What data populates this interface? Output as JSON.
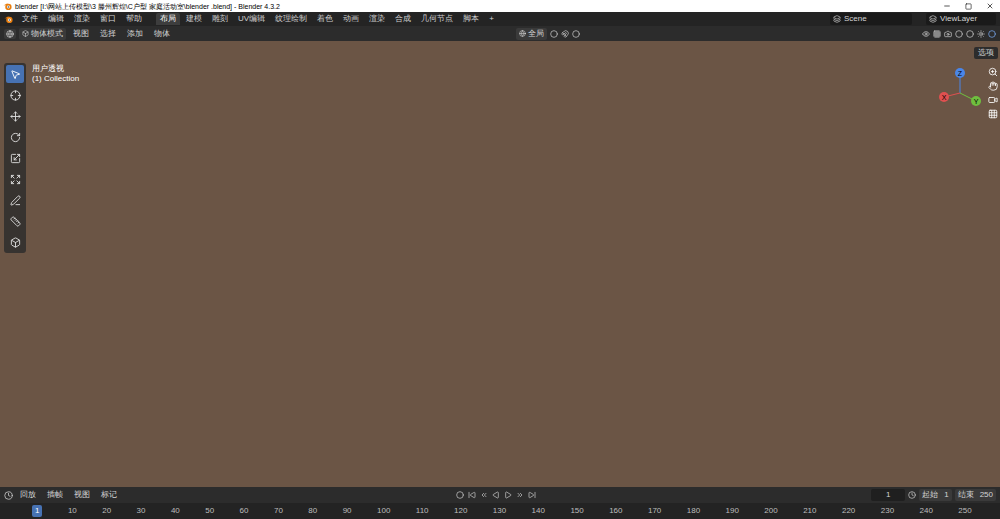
{
  "window": {
    "title": "blender [I:\\网站上传模型\\3 滕州辉煌\\C户型 家庭活动室\\blender .blend] - Blender 4.3.2"
  },
  "menubar": {
    "menus": [
      "文件",
      "编辑",
      "渲染",
      "窗口",
      "帮助"
    ],
    "workspaces": [
      {
        "label": "布局",
        "selected": true
      },
      {
        "label": "建模",
        "selected": false
      },
      {
        "label": "雕刻",
        "selected": false
      },
      {
        "label": "UV编辑",
        "selected": false
      },
      {
        "label": "纹理绘制",
        "selected": false
      },
      {
        "label": "着色",
        "selected": false
      },
      {
        "label": "动画",
        "selected": false
      },
      {
        "label": "渲染",
        "selected": false
      },
      {
        "label": "合成",
        "selected": false
      },
      {
        "label": "几何节点",
        "selected": false
      },
      {
        "label": "脚本",
        "selected": false
      }
    ],
    "add_workspace": "+",
    "scene": "Scene",
    "view_layer": "ViewLayer"
  },
  "viewport_header": {
    "mode": "物体模式",
    "menus": [
      "视图",
      "选择",
      "添加",
      "物体"
    ],
    "orientation": "全局"
  },
  "viewport": {
    "view_name": "用户透视",
    "collection": "(1) Collection",
    "options": "选项",
    "gizmo_axes": [
      "X",
      "Y",
      "Z"
    ],
    "tools": [
      {
        "kind": "select",
        "selected": true
      },
      {
        "kind": "cursor",
        "selected": false
      },
      {
        "kind": "move",
        "selected": false
      },
      {
        "kind": "rotate",
        "selected": false
      },
      {
        "kind": "scale",
        "selected": false
      },
      {
        "kind": "transform",
        "selected": false
      },
      {
        "kind": "annotate",
        "selected": false
      },
      {
        "kind": "measure",
        "selected": false
      },
      {
        "kind": "add-cube",
        "selected": false
      }
    ]
  },
  "timeline": {
    "menus": [
      "回放",
      "插帧",
      "视图",
      "标记"
    ],
    "current_frame": "1",
    "start_label": "起始",
    "start": "1",
    "end_label": "结束",
    "end": "250",
    "ticks": [
      {
        "label": "1",
        "selected": true
      },
      {
        "label": "10",
        "selected": false
      },
      {
        "label": "20",
        "selected": false
      },
      {
        "label": "30",
        "selected": false
      },
      {
        "label": "40",
        "selected": false
      },
      {
        "label": "50",
        "selected": false
      },
      {
        "label": "60",
        "selected": false
      },
      {
        "label": "70",
        "selected": false
      },
      {
        "label": "80",
        "selected": false
      },
      {
        "label": "90",
        "selected": false
      },
      {
        "label": "100",
        "selected": false
      },
      {
        "label": "110",
        "selected": false
      },
      {
        "label": "120",
        "selected": false
      },
      {
        "label": "130",
        "selected": false
      },
      {
        "label": "140",
        "selected": false
      },
      {
        "label": "150",
        "selected": false
      },
      {
        "label": "160",
        "selected": false
      },
      {
        "label": "170",
        "selected": false
      },
      {
        "label": "180",
        "selected": false
      },
      {
        "label": "190",
        "selected": false
      },
      {
        "label": "200",
        "selected": false
      },
      {
        "label": "210",
        "selected": false
      },
      {
        "label": "220",
        "selected": false
      },
      {
        "label": "230",
        "selected": false
      },
      {
        "label": "240",
        "selected": false
      },
      {
        "label": "250",
        "selected": false
      }
    ]
  }
}
